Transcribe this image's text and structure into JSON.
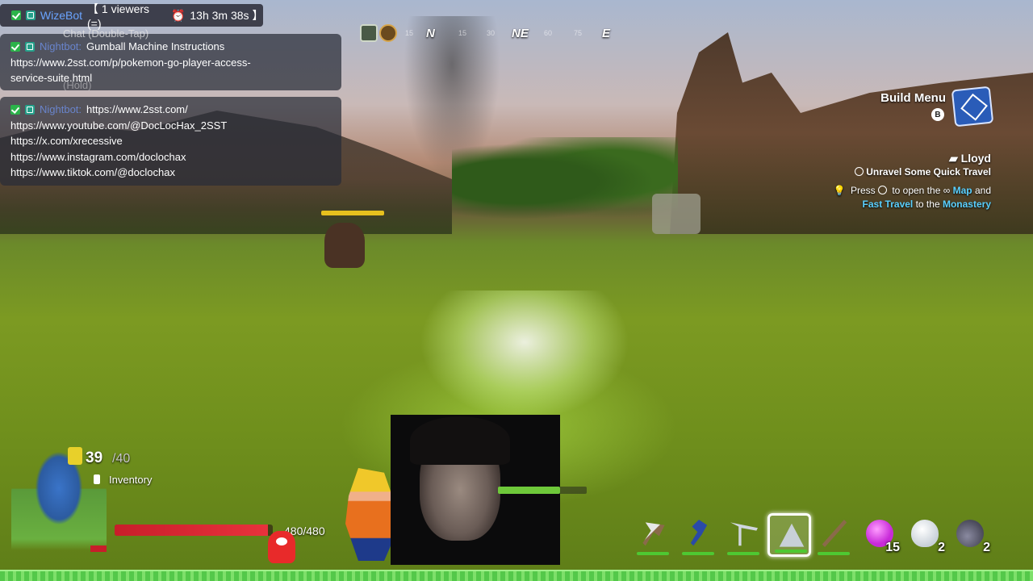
{
  "stream": {
    "bot_name": "WizeBot",
    "viewers": "【 1 viewers (=)",
    "uptime": "13h 3m 38s 】",
    "chat_hint": "Chat (Double-Tap)",
    "hold_hint": "(Hold)"
  },
  "chat": {
    "messages": [
      {
        "user": "Nightbot:",
        "lines": [
          "Gumball Machine Instructions",
          "https://www.2sst.com/p/pokemon-go-player-access-",
          "service-suite.html"
        ]
      },
      {
        "user": "Nightbot:",
        "lines": [
          "https://www.2sst.com/",
          "https://www.youtube.com/@DocLocHax_2SST",
          "https://x.com/xrecessive",
          "https://www.instagram.com/doclochax",
          "https://www.tiktok.com/@doclochax"
        ]
      }
    ]
  },
  "compass": {
    "marks": [
      "N",
      "NE",
      "E"
    ],
    "ticks": [
      "15",
      "15",
      "30",
      "60",
      "75"
    ]
  },
  "build_menu": {
    "label": "Build Menu",
    "key": "B"
  },
  "quest": {
    "npc": "Lloyd",
    "title": "Unravel Some Quick Travel",
    "line1_pre": "Press",
    "line1_mid": "to open the",
    "line1_map": "Map",
    "line1_post": "and",
    "line2_fast": "Fast Travel",
    "line2_mid": "to the",
    "line2_place": "Monastery"
  },
  "hud": {
    "count_now": "39",
    "count_max": "/40",
    "inventory_label": "Inventory",
    "hp_text": "480/480",
    "hp_fraction": 0.97,
    "companion_fraction": 0.7
  },
  "hotbar": [
    {
      "name": "axe",
      "qty": "",
      "dur": true
    },
    {
      "name": "shovel",
      "qty": "",
      "dur": true
    },
    {
      "name": "pickaxe",
      "qty": "",
      "dur": true
    },
    {
      "name": "tri-tool",
      "qty": "",
      "dur": true,
      "active": true
    },
    {
      "name": "spear",
      "qty": "",
      "dur": true
    },
    {
      "name": "gem",
      "qty": "15",
      "dur": false
    },
    {
      "name": "egg",
      "qty": "2",
      "dur": false
    },
    {
      "name": "potion",
      "qty": "2",
      "dur": false
    }
  ],
  "colors": {
    "username": "#6aa4ff",
    "highlight": "#5ad0ff",
    "hp": "#e8323c",
    "grass": "#7c9a22"
  }
}
